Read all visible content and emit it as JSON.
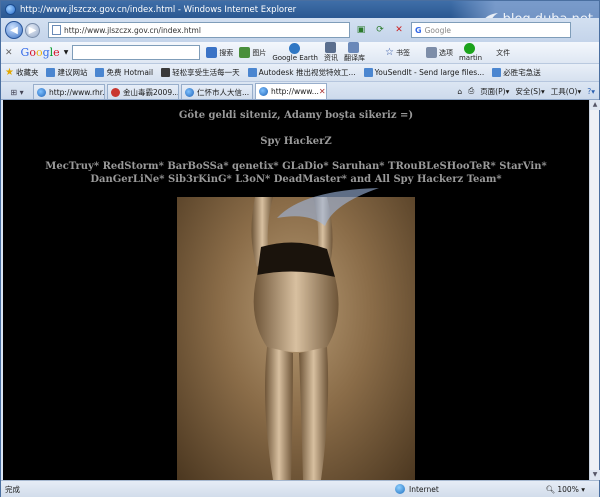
{
  "window": {
    "title": "http://www.jlszczx.gov.cn/index.html - Windows Internet Explorer",
    "watermark_text": "blog.duba.net"
  },
  "address": {
    "url": "http://www.jlszczx.gov.cn/index.html",
    "search_placeholder": "Google"
  },
  "google_toolbar": {
    "logo": "Google",
    "buttons": [
      "搜索",
      "图片",
      "Google Earth",
      "资讯",
      "翻译库",
      "书签",
      "选项",
      "martin",
      "文件"
    ]
  },
  "favorites": {
    "label": "收藏夹",
    "items": [
      "建议网站",
      "免费 Hotmail",
      "轻松享受生活每一天",
      "Autodesk 推出视觉特效工...",
      "YouSendIt - Send large files...",
      "必胜宅急送"
    ]
  },
  "tabs": [
    {
      "label": "http://www.rhr..."
    },
    {
      "label": "金山毒霸2009..."
    },
    {
      "label": "仁怀市人大信..."
    },
    {
      "label": "http://www...",
      "active": true
    }
  ],
  "command_bar": [
    "页面(P)",
    "安全(S)",
    "工具(O)"
  ],
  "page": {
    "line1": "Göte geldi siteniz, Adamy boşta sikeriz =)",
    "line2": "Spy HackerZ",
    "line3": "MecTruy* RedStorm* BarBoSSa* qenetix* GLaDio* Saruhan* TRouBLeSHooTeR* StarVin* DanGerLiNe* Sib3rKinG* L3oN* DeadMaster* and All Spy Hackerz Team*"
  },
  "status": {
    "text": "完成",
    "zone": "Internet",
    "zoom": "100%"
  }
}
